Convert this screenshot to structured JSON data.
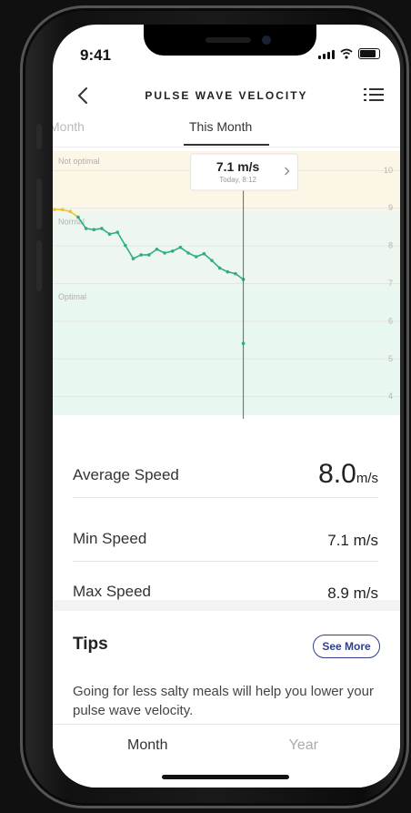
{
  "status": {
    "time": "9:41"
  },
  "nav": {
    "title": "PULSE WAVE VELOCITY"
  },
  "tabs": {
    "previous": "Month",
    "current": "This Month"
  },
  "chart_data": {
    "type": "line",
    "zones": [
      {
        "label": "Not optimal",
        "from": 8.9,
        "to": 10.5,
        "color": "#fbf6e6"
      },
      {
        "label": "Normal",
        "from": 6.9,
        "to": 8.9,
        "color": "#edf7f0"
      },
      {
        "label": "Optimal",
        "from": 3.5,
        "to": 6.9,
        "color": "#e8f7ef"
      }
    ],
    "y_ticks": [
      10,
      9,
      8,
      7,
      6,
      5,
      4
    ],
    "ylim": [
      3.4,
      10.6
    ],
    "series": [
      {
        "color": "#f0c22b",
        "x": [
          0,
          1,
          2,
          3
        ],
        "values": [
          8.95,
          8.95,
          8.9,
          8.75
        ]
      },
      {
        "color": "#2fae86",
        "x": [
          3,
          4,
          5,
          6,
          7,
          8,
          9,
          10,
          11,
          12,
          13,
          14,
          15,
          16,
          17,
          18,
          19,
          20,
          21,
          22,
          23,
          24
        ],
        "values": [
          8.75,
          8.45,
          8.42,
          8.45,
          8.3,
          8.35,
          8.0,
          7.65,
          7.75,
          7.75,
          7.9,
          7.8,
          7.85,
          7.95,
          7.8,
          7.7,
          7.78,
          7.6,
          7.4,
          7.3,
          7.25,
          7.1
        ]
      }
    ],
    "marker": {
      "x": 24,
      "value": "7.1 m/s",
      "label": "Today, 8:12"
    }
  },
  "stats": [
    {
      "label": "Average Speed",
      "value": "8.0",
      "unit": "m/s"
    },
    {
      "label": "Min Speed",
      "value": "7.1 m/s"
    },
    {
      "label": "Max Speed",
      "value": "8.9 m/s"
    }
  ],
  "tips": {
    "title": "Tips",
    "button": "See More",
    "text": "Going for less salty meals will help you lower your pulse wave velocity."
  },
  "bottom_tabs": {
    "month": "Month",
    "year": "Year"
  },
  "colors": {
    "accent": "#2d3f8c",
    "line_yellow": "#f0c22b",
    "line_green": "#2fae86"
  }
}
